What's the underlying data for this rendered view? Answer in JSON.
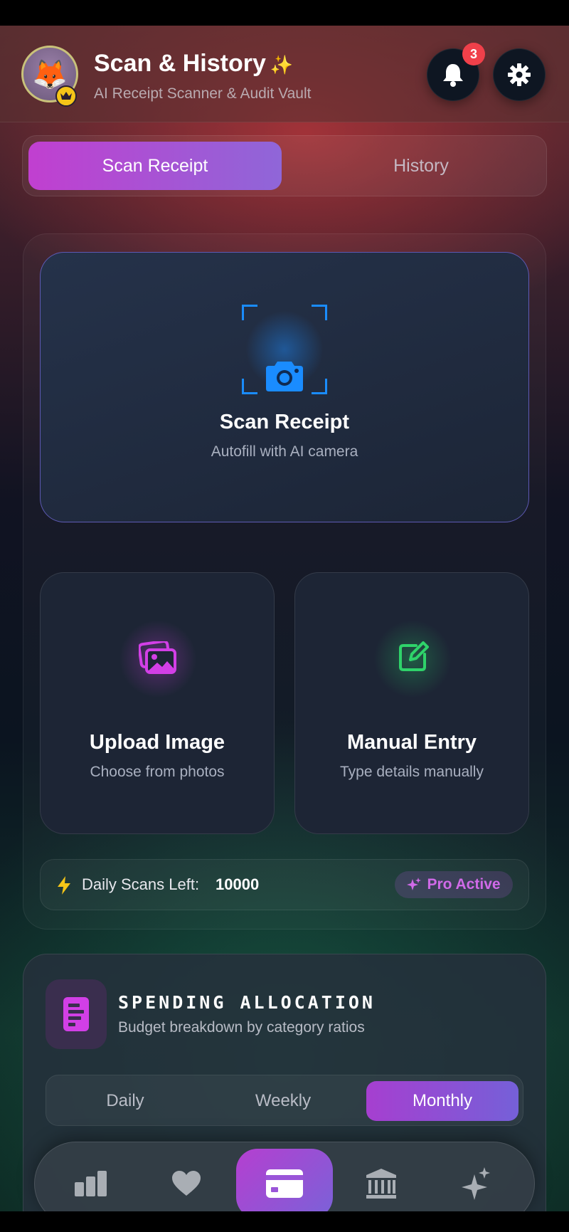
{
  "header": {
    "title": "Scan & History",
    "subtitle": "AI Receipt Scanner & Audit Vault",
    "notification_count": "3",
    "avatar_icon": "fox-emoji",
    "avatar_badge_icon": "crown-icon"
  },
  "tabs": [
    {
      "label": "Scan Receipt",
      "active": true
    },
    {
      "label": "History",
      "active": false
    }
  ],
  "scan_card": {
    "title": "Scan Receipt",
    "subtitle": "Autofill with AI camera",
    "icon": "camera-icon"
  },
  "upload_card": {
    "title": "Upload Image",
    "subtitle": "Choose from photos",
    "icon": "photos-icon"
  },
  "manual_card": {
    "title": "Manual Entry",
    "subtitle": "Type details manually",
    "icon": "edit-icon"
  },
  "scans_left": {
    "label": "Daily Scans Left:",
    "value": "10000",
    "badge": "Pro Active"
  },
  "spending": {
    "title": "SPENDING ALLOCATION",
    "subtitle": "Budget breakdown by category ratios",
    "periods": [
      "Daily",
      "Weekly",
      "Monthly"
    ],
    "selected_period": "Monthly"
  },
  "nav": {
    "items": [
      "chart-icon",
      "heart-icon",
      "card-icon",
      "bank-icon",
      "sparkles-icon"
    ],
    "active": "card-icon"
  },
  "colors": {
    "accent_purple": "#c13fd0",
    "accent_blue": "#1a8cff",
    "accent_green": "#2fd36a",
    "badge_red": "#f0404a",
    "gold": "#f5c518"
  }
}
